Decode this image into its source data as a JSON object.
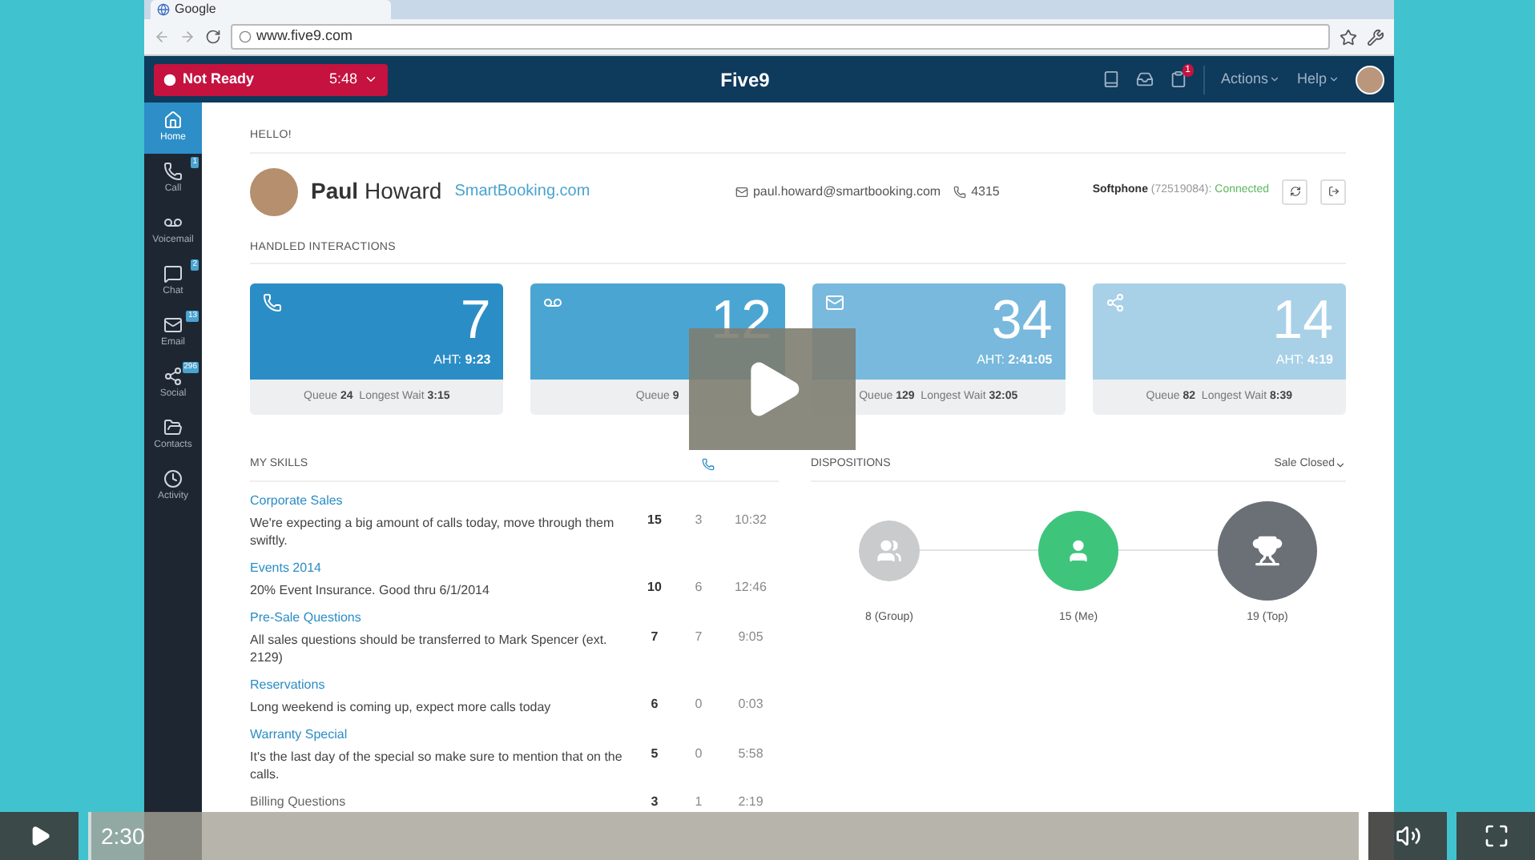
{
  "browser": {
    "tab_title": "Google",
    "url": "www.five9.com"
  },
  "app_bar": {
    "status": "Not Ready",
    "timer": "5:48",
    "logo": "Five9",
    "menus": [
      "Actions",
      "Help"
    ],
    "notification_badge": "1"
  },
  "sidebar": {
    "items": [
      {
        "label": "Home",
        "selected": true
      },
      {
        "label": "Call",
        "badge": "1",
        "selected": false
      },
      {
        "label": "Voicemail",
        "selected": false
      },
      {
        "label": "Chat",
        "badge": "2",
        "selected": false
      },
      {
        "label": "Email",
        "badge": "13",
        "selected": false
      },
      {
        "label": "Social",
        "badge": "296",
        "selected": false
      },
      {
        "label": "Contacts",
        "selected": false
      },
      {
        "label": "Activity",
        "selected": false
      }
    ]
  },
  "greeting": "HELLO!",
  "profile": {
    "first_name": "Paul",
    "last_name": "Howard",
    "company": "SmartBooking.com",
    "email": "paul.howard@smartbooking.com",
    "extension": "4315",
    "softphone_label": "Softphone",
    "softphone_id": "(72519084):",
    "softphone_status": "Connected"
  },
  "handled_title": "HANDLED INTERACTIONS",
  "cards": [
    {
      "count": "7",
      "aht_label": "AHT:",
      "aht": "9:23",
      "queue_label": "Queue",
      "queue": "24",
      "wait_label": "Longest Wait",
      "wait": "3:15",
      "color": "#2b8dc5"
    },
    {
      "count": "12",
      "queue_label": "Queue",
      "queue": "9",
      "color": "#4ba5d2"
    },
    {
      "count": "34",
      "aht_label": "AHT:",
      "aht": "2:41:05",
      "queue_label": "Queue",
      "queue": "129",
      "wait_label": "Longest Wait",
      "wait": "32:05",
      "color": "#78b9dd"
    },
    {
      "count": "14",
      "aht_label": "AHT:",
      "aht": "4:19",
      "queue_label": "Queue",
      "queue": "82",
      "wait_label": "Longest Wait",
      "wait": "8:39",
      "color": "#a8d1e8"
    }
  ],
  "skills_title": "MY SKILLS",
  "skills": [
    {
      "name": "Corporate Sales",
      "note": "We're expecting a big amount of calls today, move through them swiftly.",
      "calls": "15",
      "queue": "3",
      "time": "10:32",
      "assigned": true
    },
    {
      "name": "Events 2014",
      "note": "20% Event Insurance. Good thru 6/1/2014",
      "calls": "10",
      "queue": "6",
      "time": "12:46",
      "assigned": true
    },
    {
      "name": "Pre-Sale Questions",
      "note": "All sales questions should be transferred to Mark Spencer (ext. 2129)",
      "calls": "7",
      "queue": "7",
      "time": "9:05",
      "assigned": true
    },
    {
      "name": "Reservations",
      "note": "Long weekend is coming up, expect more calls today",
      "calls": "6",
      "queue": "0",
      "time": "0:03",
      "assigned": true
    },
    {
      "name": "Warranty Special",
      "note": "It's the last day of the special so make sure to mention that on the calls.",
      "calls": "5",
      "queue": "0",
      "time": "5:58",
      "assigned": true
    },
    {
      "name": "Billing Questions",
      "calls": "3",
      "queue": "1",
      "time": "2:19",
      "assigned": false
    }
  ],
  "dispositions": {
    "title": "DISPOSITIONS",
    "filter": "Sale Closed",
    "nodes": [
      {
        "label": "8 (Group)",
        "color": "#c9cbcd"
      },
      {
        "label": "15 (Me)",
        "color": "#3fc47c"
      },
      {
        "label": "19 (Top)",
        "color": "#6b7077"
      }
    ]
  },
  "player": {
    "time": "2:30",
    "level": 0
  }
}
